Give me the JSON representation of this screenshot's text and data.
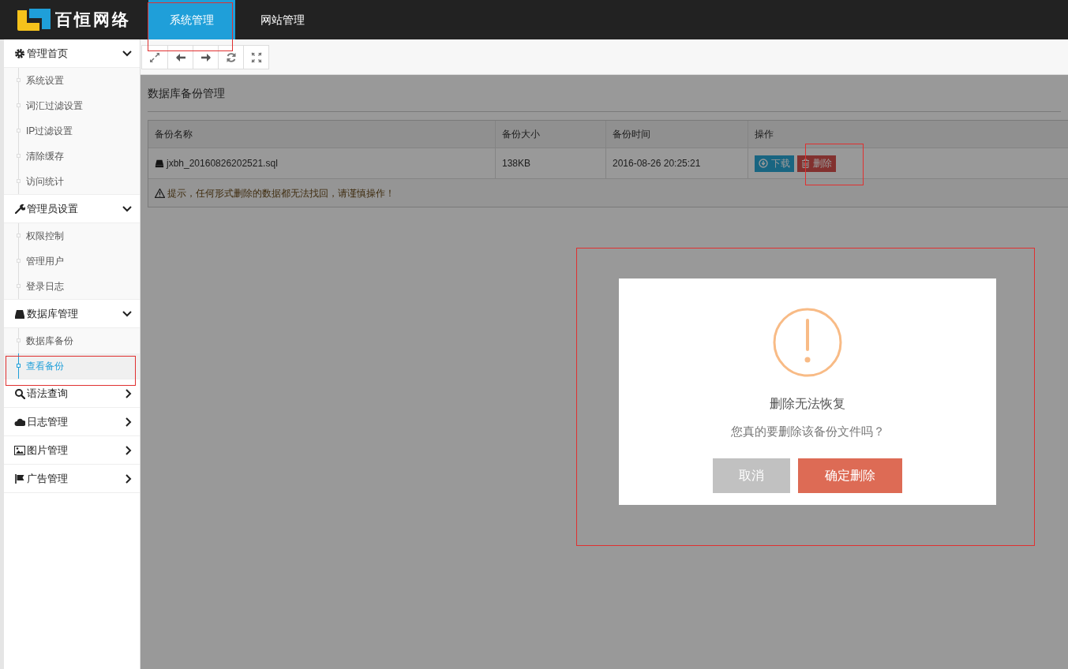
{
  "header": {
    "logo_text": "百恒网络",
    "tabs": [
      {
        "label": "系统管理",
        "selected": true
      },
      {
        "label": "网站管理",
        "selected": false
      }
    ]
  },
  "sidebar": {
    "groups": [
      {
        "label": "管理首页",
        "kind": "gear",
        "expanded": true,
        "children": [
          {
            "label": "系统设置",
            "selected": false
          },
          {
            "label": "词汇过滤设置",
            "selected": false
          },
          {
            "label": "IP过滤设置",
            "selected": false
          },
          {
            "label": "清除缓存",
            "selected": false
          },
          {
            "label": "访问统计",
            "selected": false
          }
        ]
      },
      {
        "label": "管理员设置",
        "kind": "wrench",
        "expanded": true,
        "children": [
          {
            "label": "权限控制",
            "selected": false
          },
          {
            "label": "管理用户",
            "selected": false
          },
          {
            "label": "登录日志",
            "selected": false
          }
        ]
      },
      {
        "label": "数据库管理",
        "kind": "drive",
        "expanded": true,
        "children": [
          {
            "label": "数据库备份",
            "selected": false
          },
          {
            "label": "查看备份",
            "selected": true
          }
        ]
      },
      {
        "label": "语法查询",
        "kind": "search",
        "expanded": false
      },
      {
        "label": "日志管理",
        "kind": "cloud",
        "expanded": false
      },
      {
        "label": "图片管理",
        "kind": "image",
        "expanded": false
      },
      {
        "label": "广告管理",
        "kind": "flag",
        "expanded": false
      }
    ]
  },
  "panel": {
    "title": "数据库备份管理",
    "table": {
      "columns": [
        "备份名称",
        "备份大小",
        "备份时间",
        "操作"
      ],
      "rows": [
        {
          "name": "jxbh_20160826202521.sql",
          "size": "138KB",
          "time": "2016-08-26 20:25:21",
          "actions": [
            {
              "label": "下载",
              "kind": "download"
            },
            {
              "label": "删除",
              "kind": "delete"
            }
          ]
        }
      ]
    },
    "notice": "提示，任何形式删除的数据都无法找回，请谨慎操作！"
  },
  "dialog": {
    "title": "删除无法恢复",
    "message": "您真的要删除该备份文件吗？",
    "buttons": [
      {
        "label": "取消",
        "kind": "cancel"
      },
      {
        "label": "确定删除",
        "kind": "confirm"
      }
    ]
  }
}
